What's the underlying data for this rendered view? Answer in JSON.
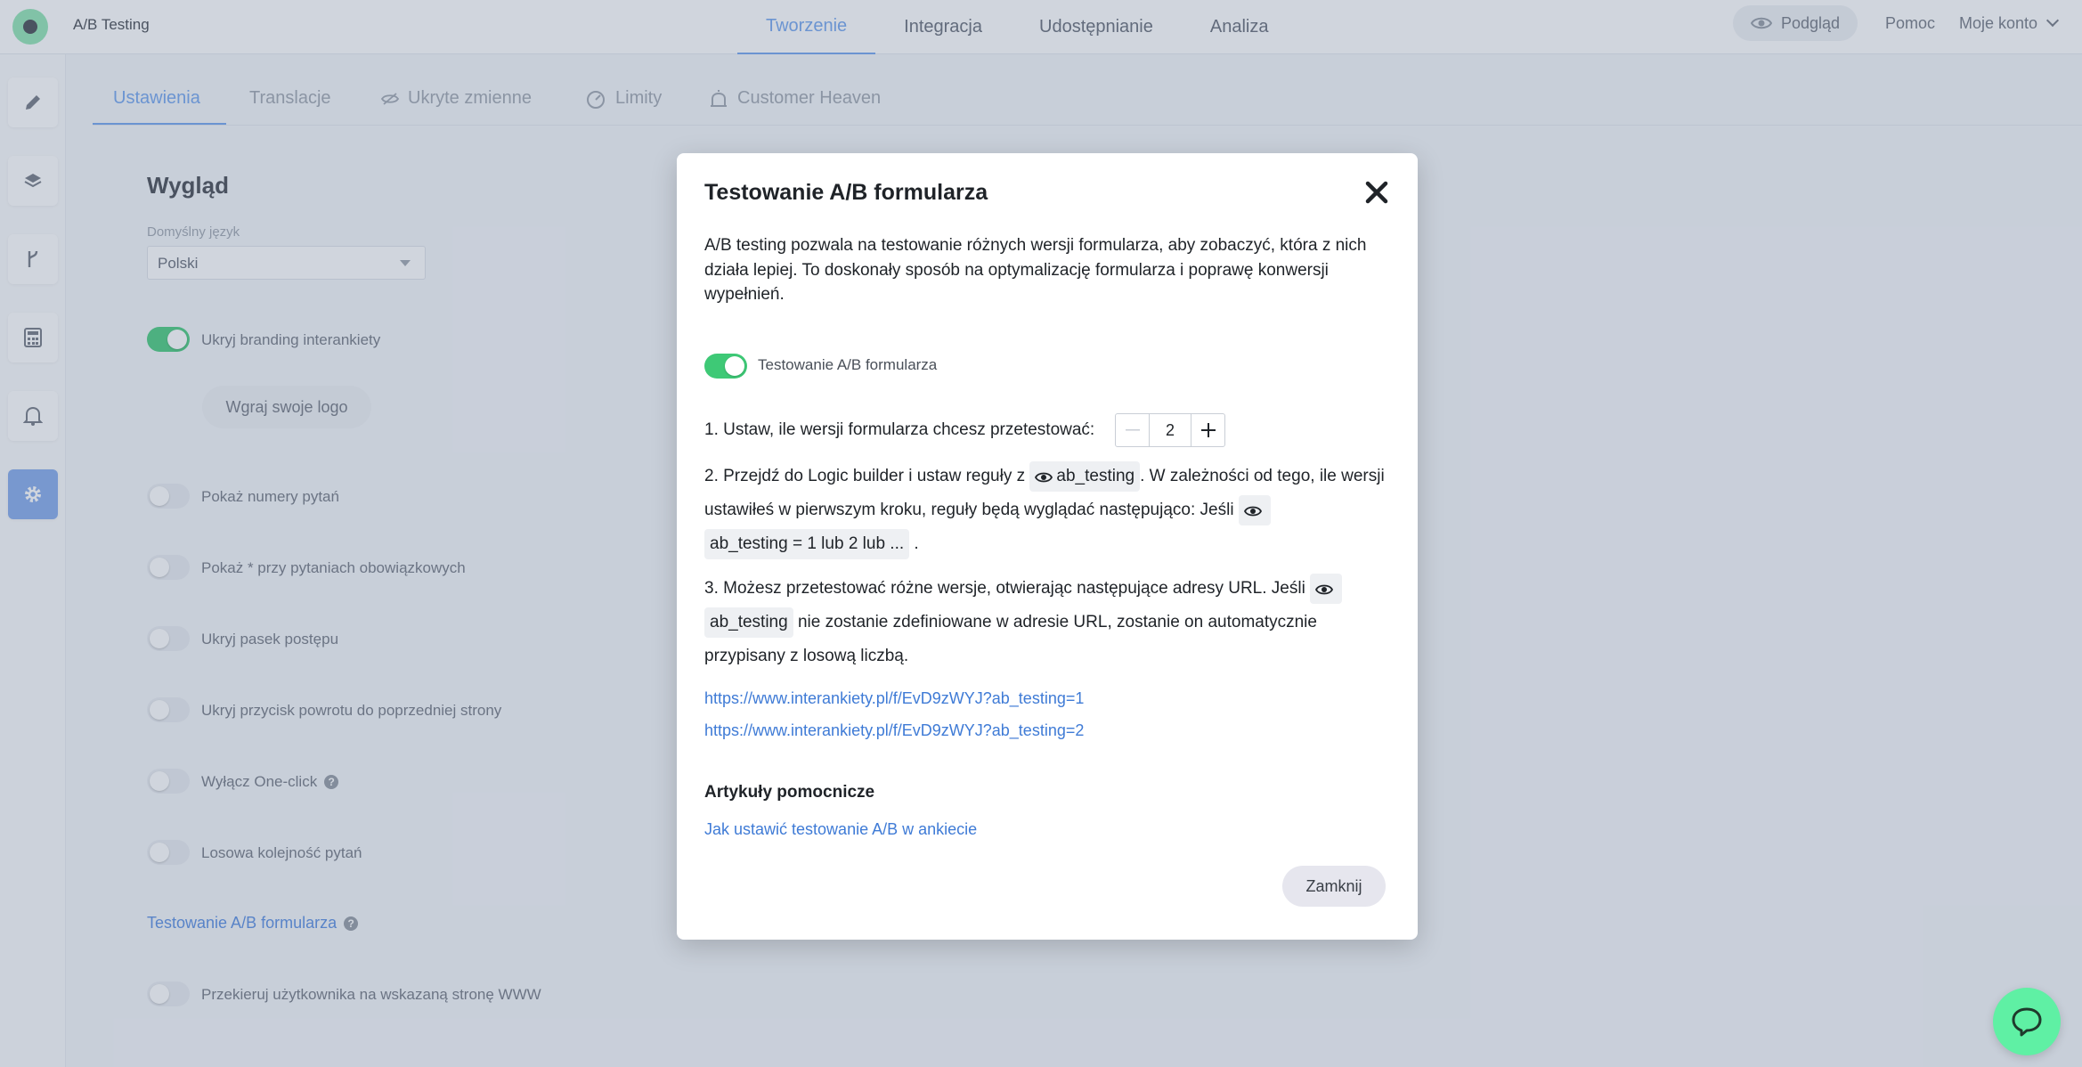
{
  "app": {
    "title": "A/B Testing"
  },
  "main_tabs": [
    {
      "label": "Tworzenie",
      "active": true
    },
    {
      "label": "Integracja",
      "active": false
    },
    {
      "label": "Udostępnianie",
      "active": false
    },
    {
      "label": "Analiza",
      "active": false
    }
  ],
  "header": {
    "preview_label": "Podgląd",
    "help_label": "Pomoc",
    "account_label": "Moje konto"
  },
  "sidebar": {
    "items": [
      "edit-icon",
      "paint-icon",
      "branch-icon",
      "calculator-icon",
      "bell-icon",
      "gear-icon"
    ],
    "active": "gear-icon"
  },
  "sub_tabs": [
    {
      "label": "Ustawienia",
      "active": true
    },
    {
      "label": "Translacje",
      "active": false
    },
    {
      "label": "Ukryte zmienne",
      "icon": "eye-off-icon",
      "active": false
    },
    {
      "label": "Limity",
      "icon": "gauge-icon",
      "active": false
    },
    {
      "label": "Customer Heaven",
      "icon": "alarm-icon",
      "active": false
    }
  ],
  "settings": {
    "section_title": "Wygląd",
    "language_label": "Domyślny język",
    "language_value": "Polski",
    "hide_branding": {
      "label": "Ukryj branding interankiety",
      "on": true
    },
    "upload_logo_label": "Wgraj swoje logo",
    "options": [
      {
        "label": "Pokaż numery pytań",
        "on": false
      },
      {
        "label": "Pokaż * przy pytaniach obowiązkowych",
        "on": false
      },
      {
        "label": "Ukryj pasek postępu",
        "on": false
      },
      {
        "label": "Ukryj przycisk powrotu do poprzedniej strony",
        "on": false
      },
      {
        "label": "Wyłącz One-click",
        "on": false
      },
      {
        "label": "Losowa kolejność pytań",
        "on": false
      }
    ],
    "ab_link_label": "Testowanie A/B formularza",
    "redirect": {
      "label": "Przekieruj użytkownika na wskazaną stronę WWW",
      "on": false
    }
  },
  "modal": {
    "title": "Testowanie A/B formularza",
    "intro": "A/B testing pozwala na testowanie różnych wersji formularza, aby zobaczyć, która z nich działa lepiej. To doskonały sposób na optymalizację formularza i poprawę konwersji wypełnień.",
    "toggle": {
      "label": "Testowanie A/B formularza",
      "on": true
    },
    "step1": "1. Ustaw, ile wersji formularza chcesz przetestować:",
    "versions": "2",
    "step2": {
      "a": "2. Przejdź do Logic builder i ustaw reguły z",
      "chip": "ab_testing",
      "b": ". W zależności od tego, ile wersji ustawiłeś w pierwszym kroku, reguły będą wyglądać następująco: Jeśli",
      "rule": "ab_testing = 1 lub 2 lub ...",
      "c": "."
    },
    "step3": {
      "a": "3. Możesz przetestować różne wersje, otwierając następujące adresy URL. Jeśli",
      "chip": "ab_testing",
      "b": "nie zostanie zdefiniowane w adresie URL, zostanie on automatycznie przypisany z losową liczbą."
    },
    "urls": [
      "https://www.interankiety.pl/f/EvD9zWYJ?ab_testing=1",
      "https://www.interankiety.pl/f/EvD9zWYJ?ab_testing=2"
    ],
    "articles_title": "Artykuły pomocnicze",
    "article_link": "Jak ustawić testowanie A/B w ankiecie",
    "close_label": "Zamknij"
  },
  "colors": {
    "accent": "#6aa0ee",
    "toggle_on": "#3ec976",
    "link": "#3f7bd6",
    "chat": "#5ff0a4"
  }
}
